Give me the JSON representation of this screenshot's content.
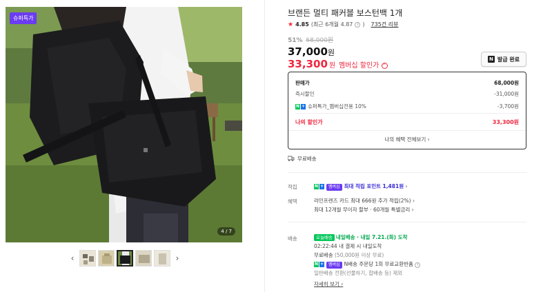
{
  "gallery": {
    "badge": "슈퍼특가",
    "counter": "4 / 7",
    "prev_arrow": "‹",
    "next_arrow": "›",
    "thumbnails": [
      "thumb-1",
      "thumb-2",
      "thumb-3",
      "thumb-4",
      "thumb-5"
    ],
    "active_thumb_index": 2
  },
  "product": {
    "title": "브랜든 멀티 패커블 보스턴백 1개",
    "rating": "4.85",
    "rating_sub": "(최근 6개월 4.87",
    "rating_sub_close": ")",
    "review_count": "735건 리뷰",
    "discount_rate": "51%",
    "original_price": "68,000원",
    "price": "37,000",
    "price_unit": "원",
    "member_price": "33,300",
    "member_price_unit": "원",
    "member_label": "멤버십 할인가",
    "coupon_button": "발급 완료"
  },
  "price_box": {
    "rows": [
      {
        "label": "판매가",
        "value": "68,000원"
      },
      {
        "label": "즉시할인",
        "value": "-31,000원"
      },
      {
        "label": "슈퍼특가_멤버십전용 10%",
        "value": "-3,700원"
      }
    ],
    "my_discount_label": "나의 할인가",
    "my_discount_value": "33,300원",
    "more_link": "나의 혜택 전체보기 ›"
  },
  "shipping_free": "무료배송",
  "points": {
    "label": "적립",
    "badge": "멤버십",
    "text": "최대 적립 포인트",
    "amount": "1,481원",
    "chevron": "›"
  },
  "benefits": {
    "label": "혜택",
    "line1": "라인프렌즈 카드 최대 666원 추가 적립(2%) ›",
    "line2": "최대 12개월 무이자 할부 · 60개월 특별금리 ›"
  },
  "delivery": {
    "label": "배송",
    "today_badge": "오늘배송",
    "today_text": "내일배송 · 내일 7.21.(화) 도착",
    "cutoff": "02:22:44  내 결제 시 내일도착",
    "free_line": "무료배송",
    "free_condition": "(50,000원 이상 무료)",
    "return_badge": "멤버십",
    "return_text": "N배송 주문당 1회 무료교환반품",
    "general_text": "일반배송 전환(선물하기, 합배송 등) 제외",
    "detail_link": "자세히 보기 ›"
  },
  "colors": {
    "accent_red": "#f0263d",
    "naver_green": "#03c75a",
    "membership_purple": "#6b3cf0"
  }
}
